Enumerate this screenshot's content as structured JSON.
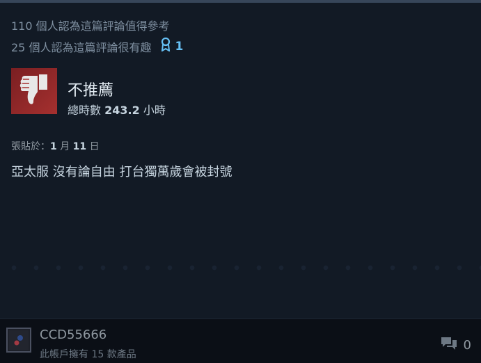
{
  "review": {
    "helpful_text": "110 個人認為這篇評論值得參考",
    "funny_text": "25 個人認為這篇評論很有趣",
    "award_count": "1",
    "award_icon": "award-ribbon-icon",
    "verdict": "不推薦",
    "verdict_icon": "thumbs-down-icon",
    "hours_label": "總時數",
    "hours_value": "243.2",
    "hours_unit": "小時",
    "posted_label": "張貼於：",
    "posted_month": "1",
    "posted_month_unit": "月",
    "posted_day": "11",
    "posted_day_unit": "日",
    "body": "亞太服 沒有論自由 打台獨萬歲會被封號"
  },
  "author": {
    "username": "CCD55666",
    "products": "此帳戶擁有 15 款產品"
  },
  "comments": {
    "count": "0",
    "icon": "comment-bubbles-icon"
  },
  "colors": {
    "background": "#0f141d",
    "card": "#121a25",
    "thumb_red": "#a5302f",
    "award_blue": "#66c0f4"
  }
}
